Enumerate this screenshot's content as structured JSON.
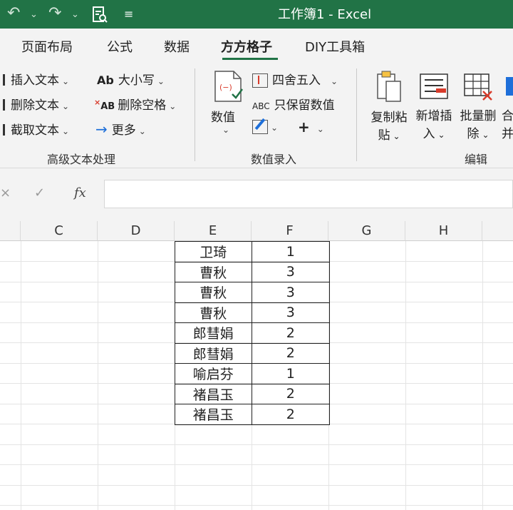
{
  "titlebar": {
    "title": "工作簿1  -  Excel"
  },
  "tabs": [
    {
      "label": "页面布局"
    },
    {
      "label": "公式"
    },
    {
      "label": "数据"
    },
    {
      "label": "方方格子",
      "active": true
    },
    {
      "label": "DIY工具箱"
    }
  ],
  "ribbon": {
    "text_group": {
      "label": "高级文本处理",
      "insert_text": "插入文本",
      "delete_text": "删除文本",
      "extract_text": "截取文本",
      "case": "大小写",
      "case_icon_text": "Ab",
      "remove_spaces": "删除空格",
      "remove_spaces_icon_text": "AB",
      "more": "更多"
    },
    "number_group": {
      "label": "数值录入",
      "value": "数值",
      "round": "四舍五入",
      "keep_values": "只保留数值",
      "keep_values_icon_text": "ABC",
      "plus": "+"
    },
    "edit_group": {
      "label": "编辑",
      "copy_paste_line1": "复制粘",
      "copy_paste_line2": "贴",
      "insert_new_line1": "新增插",
      "insert_new_line2": "入",
      "batch_delete_line1": "批量删",
      "batch_delete_line2": "除",
      "merge_partial_top": "合",
      "merge_partial_bottom": "并"
    }
  },
  "formula_bar": {
    "fx": "fx",
    "value": ""
  },
  "columns": [
    "C",
    "D",
    "E",
    "F",
    "G",
    "H"
  ],
  "table": [
    {
      "name": "卫琦",
      "value": "1"
    },
    {
      "name": "曹秋",
      "value": "3"
    },
    {
      "name": "曹秋",
      "value": "3"
    },
    {
      "name": "曹秋",
      "value": "3"
    },
    {
      "name": "郎彗娟",
      "value": "2"
    },
    {
      "name": "郎彗娟",
      "value": "2"
    },
    {
      "name": "喻启芬",
      "value": "1"
    },
    {
      "name": "褚昌玉",
      "value": "2"
    },
    {
      "name": "褚昌玉",
      "value": "2"
    }
  ],
  "colors": {
    "excel_green": "#217346",
    "ribbon_bg": "#f3f3f3",
    "accent_blue": "#1e6fd9",
    "accent_red": "#d83b2b"
  }
}
